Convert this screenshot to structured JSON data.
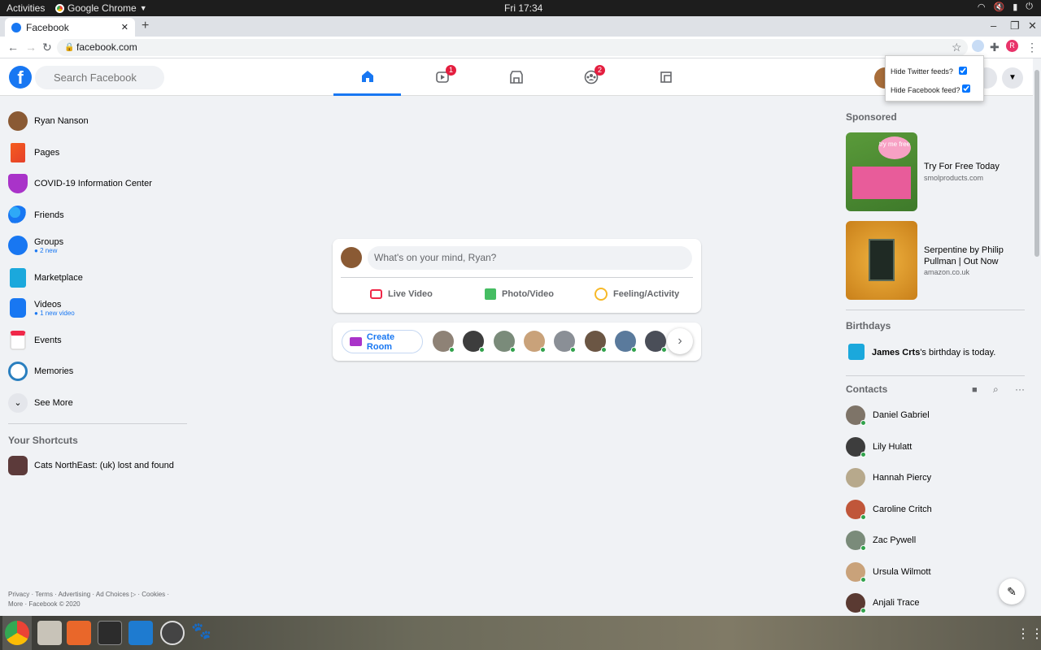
{
  "os": {
    "activities": "Activities",
    "app_name": "Google Chrome",
    "clock": "Fri 17:34"
  },
  "browser": {
    "tab_title": "Facebook",
    "url": "facebook.com",
    "profile_initial": "R"
  },
  "fb": {
    "logo_letter": "f",
    "search_placeholder": "Search Facebook",
    "nav_badges": {
      "watch": "1",
      "groups": "2"
    }
  },
  "popup": {
    "twitter_label": "Hide Twitter feeds?",
    "facebook_label": "Hide Facebook feed?"
  },
  "left_nav": {
    "items": [
      {
        "label": "Ryan Nanson",
        "sub": ""
      },
      {
        "label": "Pages",
        "sub": ""
      },
      {
        "label": "COVID-19 Information Center",
        "sub": ""
      },
      {
        "label": "Friends",
        "sub": ""
      },
      {
        "label": "Groups",
        "sub": "2 new"
      },
      {
        "label": "Marketplace",
        "sub": ""
      },
      {
        "label": "Videos",
        "sub": "1 new video"
      },
      {
        "label": "Events",
        "sub": ""
      },
      {
        "label": "Memories",
        "sub": ""
      },
      {
        "label": "See More",
        "sub": ""
      }
    ],
    "shortcuts_title": "Your Shortcuts",
    "shortcut": "Cats NorthEast: (uk) lost and found",
    "footer_line1": "Privacy · Terms · Advertising · Ad Choices ▷ · Cookies ·",
    "footer_line2": "More · Facebook © 2020"
  },
  "composer": {
    "placeholder": "What's on your mind, Ryan?",
    "live_video": "Live Video",
    "photo_video": "Photo/Video",
    "feeling": "Feeling/Activity",
    "create_room": "Create Room"
  },
  "right": {
    "sponsored_title": "Sponsored",
    "ads": [
      {
        "title": "Try For Free Today",
        "domain": "smolproducts.com",
        "image_text": "try me free"
      },
      {
        "title": "Serpentine by Philip Pullman | Out Now",
        "domain": "amazon.co.uk"
      }
    ],
    "birthdays_title": "Birthdays",
    "birthday_name": "James Crts",
    "birthday_rest": "'s birthday is today.",
    "contacts_title": "Contacts",
    "contacts": [
      "Daniel Gabriel",
      "Lily Hulatt",
      "Hannah Piercy",
      "Caroline Critch",
      "Zac Pywell",
      "Ursula Wilmott",
      "Anjali Trace"
    ]
  },
  "colors": {
    "brand": "#1877f2",
    "badge": "#e41e3f",
    "online": "#31a24c"
  }
}
